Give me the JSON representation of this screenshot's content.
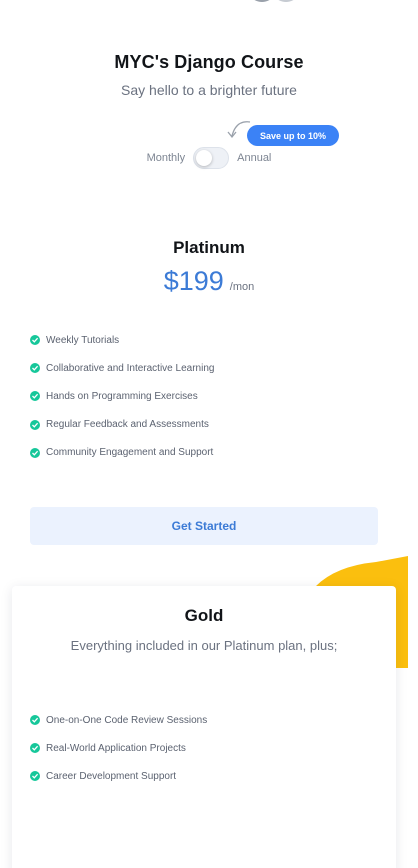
{
  "hero": {
    "title": "MYC's Django Course",
    "subtitle": "Say hello to a brighter future"
  },
  "billing": {
    "save_badge": "Save up to 10%",
    "monthly_label": "Monthly",
    "annual_label": "Annual",
    "toggle_state": "monthly"
  },
  "platinum": {
    "name": "Platinum",
    "price": "$199",
    "period": "/mon",
    "features": [
      "Weekly Tutorials",
      "Collaborative and Interactive Learning",
      "Hands on Programming Exercises",
      "Regular Feedback and Assessments",
      "Community Engagement and Support"
    ],
    "cta_label": "Get Started"
  },
  "gold": {
    "name": "Gold",
    "subtitle": "Everything included in our Platinum plan, plus;",
    "features": [
      "One-on-One Code Review Sessions",
      "Real-World Application Projects",
      "Career Development Support"
    ]
  },
  "colors": {
    "accent": "#3c7bd6",
    "badge": "#3b82f6",
    "check": "#16c79a",
    "ribbon": "#fbbf0e",
    "cta_background": "#ebf2fe"
  },
  "icons": {
    "feature_check": "check-circle-icon",
    "badge_pointer": "curved-arrow-icon"
  }
}
